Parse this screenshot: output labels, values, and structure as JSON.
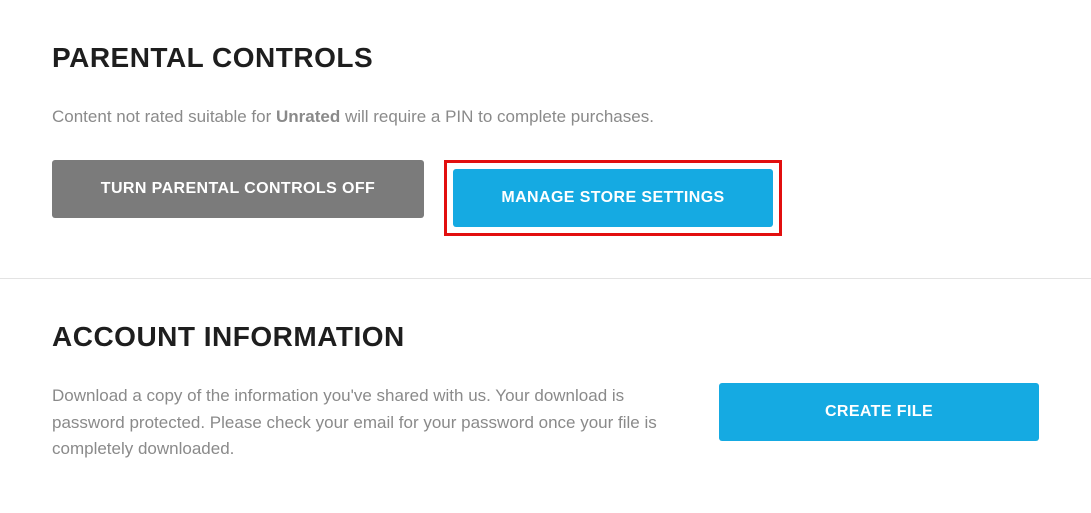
{
  "parental_controls": {
    "title": "PARENTAL CONTROLS",
    "desc_prefix": "Content not rated suitable for ",
    "desc_rating": "Unrated",
    "desc_suffix": " will require a PIN to complete purchases.",
    "turn_off_label": "TURN PARENTAL CONTROLS OFF",
    "manage_label": "MANAGE STORE SETTINGS"
  },
  "account_info": {
    "title": "ACCOUNT INFORMATION",
    "description": "Download a copy of the information you've shared with us. Your download is password protected. Please check your email for your password once your file is completely downloaded.",
    "create_label": "CREATE FILE"
  }
}
